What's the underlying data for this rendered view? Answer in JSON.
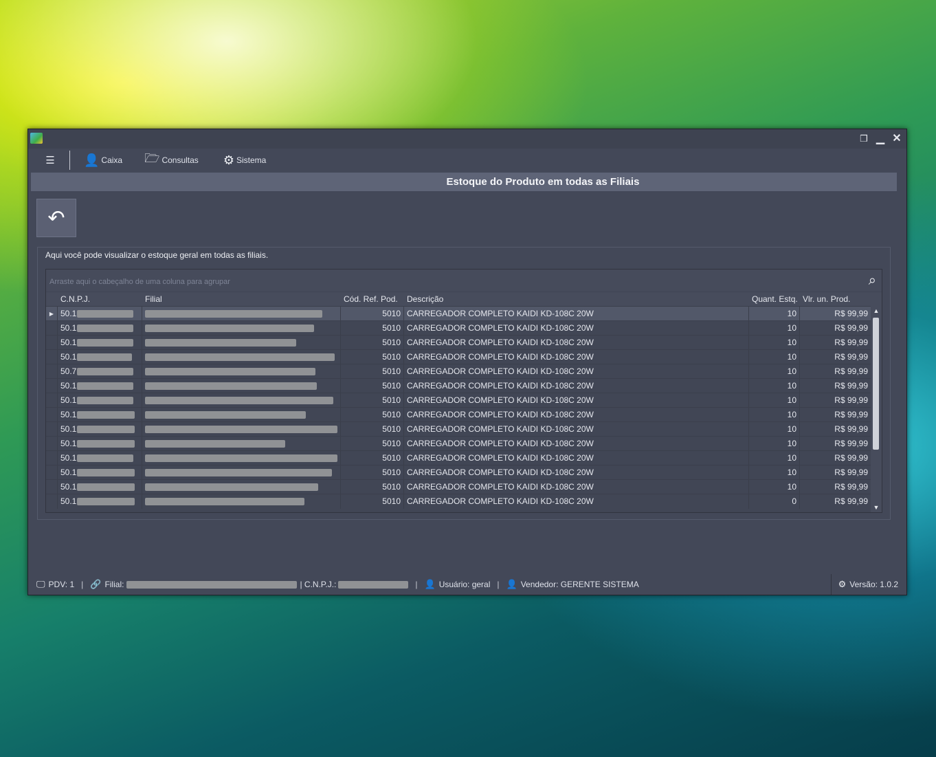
{
  "window": {
    "icon": "app-icon",
    "controls": [
      "restore-icon",
      "minimize-icon",
      "close-icon"
    ]
  },
  "toolbar": {
    "menu_icon": "menu-icon",
    "items": [
      {
        "label": "Caixa",
        "icon": "user-cash-icon"
      },
      {
        "label": "Consultas",
        "icon": "folder-icon"
      },
      {
        "label": "Sistema",
        "icon": "gear-icon"
      }
    ]
  },
  "page": {
    "title": "Estoque do Produto em todas as Filiais",
    "back_icon": "back-arrow-icon",
    "description": "Aqui você pode visualizar o estoque geral em todas as filiais."
  },
  "grid": {
    "group_hint": "Arraste aqui o cabeçalho de uma coluna para agrupar",
    "columns": [
      "C.N.P.J.",
      "Filial",
      "Cód. Ref. Pod.",
      "Descrição",
      "Quant. Estq.",
      "Vlr. un. Prod."
    ],
    "rows": [
      {
        "cnpj": "50.1",
        "ref": "5010",
        "desc": "CARREGADOR COMPLETO KAIDI KD-108C 20W",
        "qty": "10",
        "price": "R$ 99,99"
      },
      {
        "cnpj": "50.1",
        "ref": "5010",
        "desc": "CARREGADOR COMPLETO KAIDI KD-108C 20W",
        "qty": "10",
        "price": "R$ 99,99"
      },
      {
        "cnpj": "50.1",
        "ref": "5010",
        "desc": "CARREGADOR COMPLETO KAIDI KD-108C 20W",
        "qty": "10",
        "price": "R$ 99,99"
      },
      {
        "cnpj": "50.1",
        "ref": "5010",
        "desc": "CARREGADOR COMPLETO KAIDI KD-108C 20W",
        "qty": "10",
        "price": "R$ 99,99"
      },
      {
        "cnpj": "50.7",
        "ref": "5010",
        "desc": "CARREGADOR COMPLETO KAIDI KD-108C 20W",
        "qty": "10",
        "price": "R$ 99,99"
      },
      {
        "cnpj": "50.1",
        "ref": "5010",
        "desc": "CARREGADOR COMPLETO KAIDI KD-108C 20W",
        "qty": "10",
        "price": "R$ 99,99"
      },
      {
        "cnpj": "50.1",
        "ref": "5010",
        "desc": "CARREGADOR COMPLETO KAIDI KD-108C 20W",
        "qty": "10",
        "price": "R$ 99,99"
      },
      {
        "cnpj": "50.1",
        "ref": "5010",
        "desc": "CARREGADOR COMPLETO KAIDI KD-108C 20W",
        "qty": "10",
        "price": "R$ 99,99"
      },
      {
        "cnpj": "50.1",
        "ref": "5010",
        "desc": "CARREGADOR COMPLETO KAIDI KD-108C 20W",
        "qty": "10",
        "price": "R$ 99,99"
      },
      {
        "cnpj": "50.1",
        "ref": "5010",
        "desc": "CARREGADOR COMPLETO KAIDI KD-108C 20W",
        "qty": "10",
        "price": "R$ 99,99"
      },
      {
        "cnpj": "50.1",
        "ref": "5010",
        "desc": "CARREGADOR COMPLETO KAIDI KD-108C 20W",
        "qty": "10",
        "price": "R$ 99,99"
      },
      {
        "cnpj": "50.1",
        "ref": "5010",
        "desc": "CARREGADOR COMPLETO KAIDI KD-108C 20W",
        "qty": "10",
        "price": "R$ 99,99"
      },
      {
        "cnpj": "50.1",
        "ref": "5010",
        "desc": "CARREGADOR COMPLETO KAIDI KD-108C 20W",
        "qty": "10",
        "price": "R$ 99,99"
      },
      {
        "cnpj": "50.1",
        "ref": "5010",
        "desc": "CARREGADOR COMPLETO KAIDI KD-108C 20W",
        "qty": "0",
        "price": "R$ 99,99"
      }
    ]
  },
  "status": {
    "pdv": "PDV: 1",
    "filial_label": "Filial:",
    "cnpj_label": "| C.N.P.J.:",
    "usuario": "Usuário: geral",
    "vendedor": "Vendedor: GERENTE SISTEMA",
    "versao": "Versão: 1.0.2"
  }
}
